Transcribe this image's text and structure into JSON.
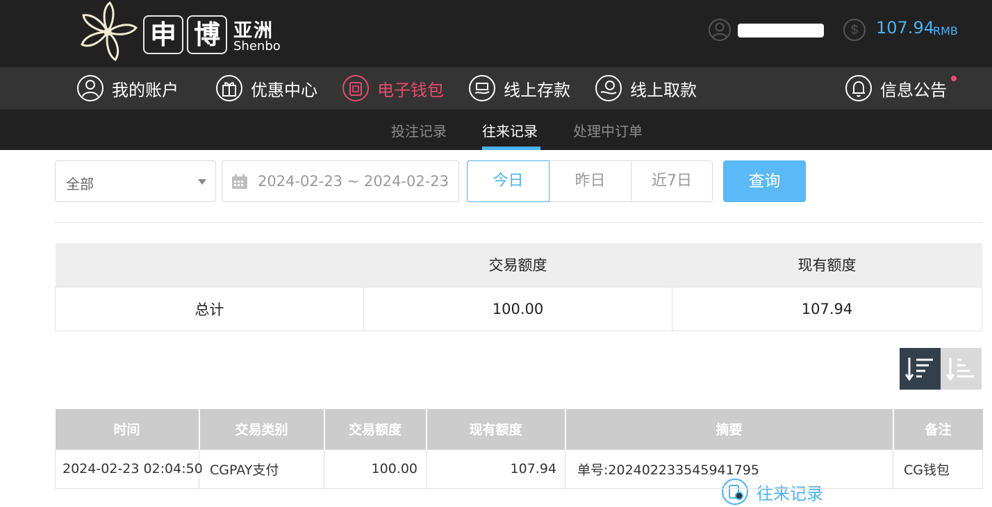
{
  "header": {
    "logo_char_1": "申",
    "logo_char_2": "博",
    "logo_cn": "亚洲",
    "logo_en": "Shenbo",
    "balance": "107.94",
    "balance_unit": "RMB",
    "colors": {
      "accent": "#4ab2f3",
      "wallet": "#e74a6e",
      "header_bg": "#212121",
      "nav_bg": "#343434"
    }
  },
  "nav": {
    "items": [
      {
        "label": "我的账户",
        "icon": "user-icon"
      },
      {
        "label": "优惠中心",
        "icon": "gift-icon"
      },
      {
        "label": "电子钱包",
        "icon": "wallet-icon"
      },
      {
        "label": "线上存款",
        "icon": "deposit-icon"
      },
      {
        "label": "线上取款",
        "icon": "withdraw-icon"
      },
      {
        "label": "往来记录",
        "icon": "records-icon"
      },
      {
        "label": "信息公告",
        "icon": "bell-icon"
      }
    ]
  },
  "subnav": {
    "items": [
      "投注记录",
      "往来记录",
      "处理中订单"
    ],
    "active": "往来记录"
  },
  "filter": {
    "type_value": "全部",
    "date_range": "2024-02-23 ~ 2024-02-23",
    "today": "今日",
    "yesterday": "昨日",
    "last7": "近7日",
    "query": "查询"
  },
  "summary": {
    "headers": [
      "",
      "交易额度",
      "现有额度"
    ],
    "row_label": "总计",
    "amount": "100.00",
    "balance": "107.94"
  },
  "records": {
    "headers": [
      "时间",
      "交易类别",
      "交易额度",
      "现有额度",
      "摘要",
      "备注"
    ],
    "rows": [
      {
        "time": "2024-02-23 02:04:50",
        "type": "CGPAY支付",
        "amount": "100.00",
        "balance": "107.94",
        "summary": "单号:20240223354594179​5",
        "note": "CG钱包"
      }
    ]
  }
}
